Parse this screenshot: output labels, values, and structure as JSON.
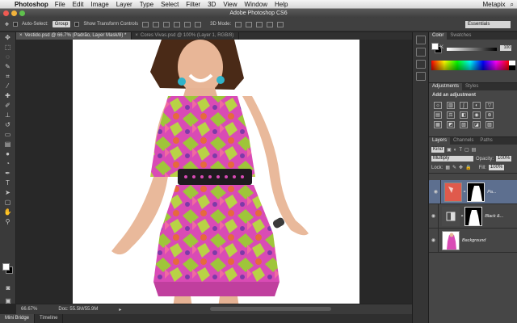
{
  "menubar": {
    "app_name": "Photoshop",
    "items": [
      "File",
      "Edit",
      "Image",
      "Layer",
      "Type",
      "Select",
      "Filter",
      "3D",
      "View",
      "Window",
      "Help"
    ],
    "status_right": "Metapix"
  },
  "window": {
    "title": "Adobe Photoshop CS6"
  },
  "options_bar": {
    "auto_select_label": "Auto-Select:",
    "auto_select_value": "Group",
    "transform_controls_label": "Show Transform Controls",
    "mode_3d_label": "3D Mode:",
    "workspace": "Essentials"
  },
  "doc_tabs": [
    {
      "label": "Vestido.psd @ 66.7% (Padrão, Layer Mask/8) *",
      "active": true
    },
    {
      "label": "Cores Vivas.psd @ 100% (Layer 1, RGB/8)",
      "active": false
    }
  ],
  "status_bar": {
    "zoom": "66.67%",
    "doc_info": "Doc: 55.5M/55.9M"
  },
  "bottom_tabs": [
    "Mini Bridge",
    "Timeline"
  ],
  "color_panel": {
    "tabs": [
      "Color",
      "Swatches"
    ],
    "channel_label": "K",
    "channel_value": "100"
  },
  "adjustments_panel": {
    "tabs": [
      "Adjustments",
      "Styles"
    ],
    "title": "Add an adjustment",
    "icons": [
      "brightness-contrast-icon",
      "levels-icon",
      "curves-icon",
      "exposure-icon",
      "vibrance-icon",
      "hue-saturation-icon",
      "color-balance-icon",
      "black-white-icon",
      "photo-filter-icon",
      "channel-mixer-icon",
      "color-lookup-icon",
      "invert-icon",
      "posterize-icon",
      "threshold-icon",
      "gradient-map-icon",
      "selective-color-icon"
    ]
  },
  "layers_panel": {
    "tabs": [
      "Layers",
      "Channels",
      "Paths"
    ],
    "filter_label": "Kind",
    "blend_mode": "Multiply",
    "opacity_label": "Opacity:",
    "opacity_value": "100%",
    "lock_label": "Lock:",
    "fill_label": "Fill:",
    "fill_value": "100%",
    "layers": [
      {
        "name": "Pa...",
        "selected": true,
        "has_mask": true
      },
      {
        "name": "Black &...",
        "selected": false,
        "has_mask": true
      },
      {
        "name": "Background",
        "selected": false,
        "has_mask": false
      }
    ],
    "footer_icons": [
      "link-icon",
      "fx-icon",
      "mask-icon",
      "adjustment-icon",
      "group-icon",
      "new-layer-icon",
      "trash-icon"
    ]
  },
  "colors": {
    "accent_selected_layer": "#5d6f8f",
    "dress_pink": "#d94bb5",
    "dress_green": "#9fc53a"
  }
}
